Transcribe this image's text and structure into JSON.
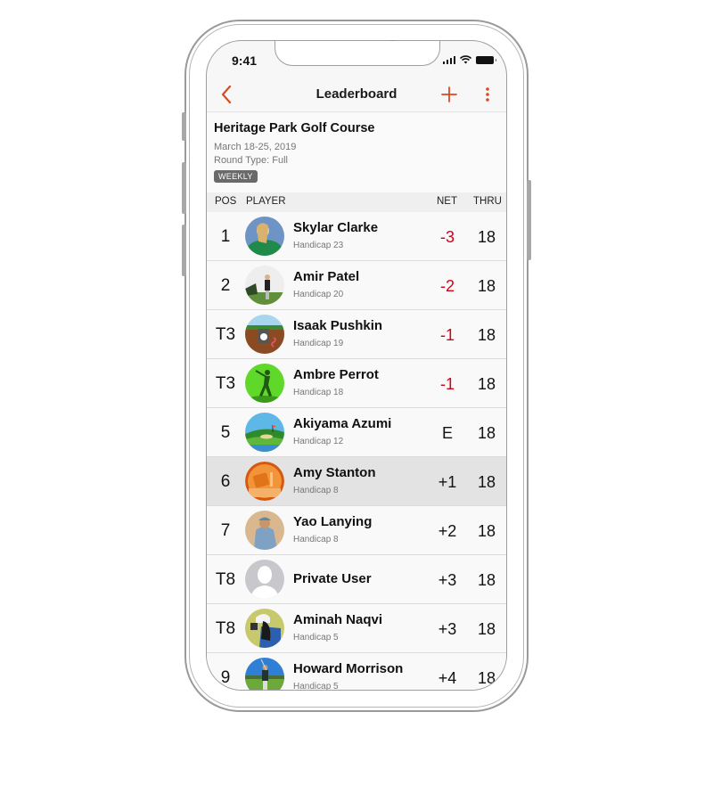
{
  "status_bar": {
    "time": "9:41"
  },
  "nav": {
    "title": "Leaderboard",
    "back_icon": "chevron-left-icon",
    "add_icon": "plus-icon",
    "more_icon": "more-vertical-icon"
  },
  "colors": {
    "accent": "#d94a1e",
    "negative": "#d0021b",
    "badge": "#6a6a6a"
  },
  "course": {
    "name": "Heritage Park Golf Course",
    "dates": "March 18-25, 2019",
    "round_type": "Round Type: Full",
    "badge": "WEEKLY"
  },
  "table": {
    "headers": {
      "pos": "POS",
      "player": "PLAYER",
      "net": "NET",
      "thru": "THRU"
    },
    "rows": [
      {
        "pos": "1",
        "name": "Skylar Clarke",
        "handicap": "Handicap 23",
        "net": "-3",
        "thru": "18",
        "avatar": "photo-golfer-green-shirt"
      },
      {
        "pos": "2",
        "name": "Amir Patel",
        "handicap": "Handicap 20",
        "net": "-2",
        "thru": "18",
        "avatar": "photo-golfer-swing"
      },
      {
        "pos": "T3",
        "name": "Isaak Pushkin",
        "handicap": "Handicap 19",
        "net": "-1",
        "thru": "18",
        "avatar": "illustration-golf-hole"
      },
      {
        "pos": "T3",
        "name": "Ambre Perrot",
        "handicap": "Handicap 18",
        "net": "-1",
        "thru": "18",
        "avatar": "illustration-golfer-silhouette"
      },
      {
        "pos": "5",
        "name": "Akiyama Azumi",
        "handicap": "Handicap 12",
        "net": "E",
        "thru": "18",
        "avatar": "illustration-golf-course"
      },
      {
        "pos": "6",
        "name": "Amy Stanton",
        "handicap": "Handicap 8",
        "net": "+1",
        "thru": "18",
        "avatar": "illustration-golf-bag-orange",
        "highlighted": true
      },
      {
        "pos": "7",
        "name": "Yao Lanying",
        "handicap": "Handicap 8",
        "net": "+2",
        "thru": "18",
        "avatar": "photo-golfer-cap"
      },
      {
        "pos": "T8",
        "name": "Private User",
        "handicap": "",
        "net": "+3",
        "thru": "18",
        "avatar": "default-user"
      },
      {
        "pos": "T8",
        "name": "Aminah Naqvi",
        "handicap": "Handicap 5",
        "net": "+3",
        "thru": "18",
        "avatar": "photo-golfer-white-cap"
      },
      {
        "pos": "9",
        "name": "Howard Morrison",
        "handicap": "Handicap 5",
        "net": "+4",
        "thru": "18",
        "avatar": "photo-golfer-blue-sky"
      }
    ]
  }
}
